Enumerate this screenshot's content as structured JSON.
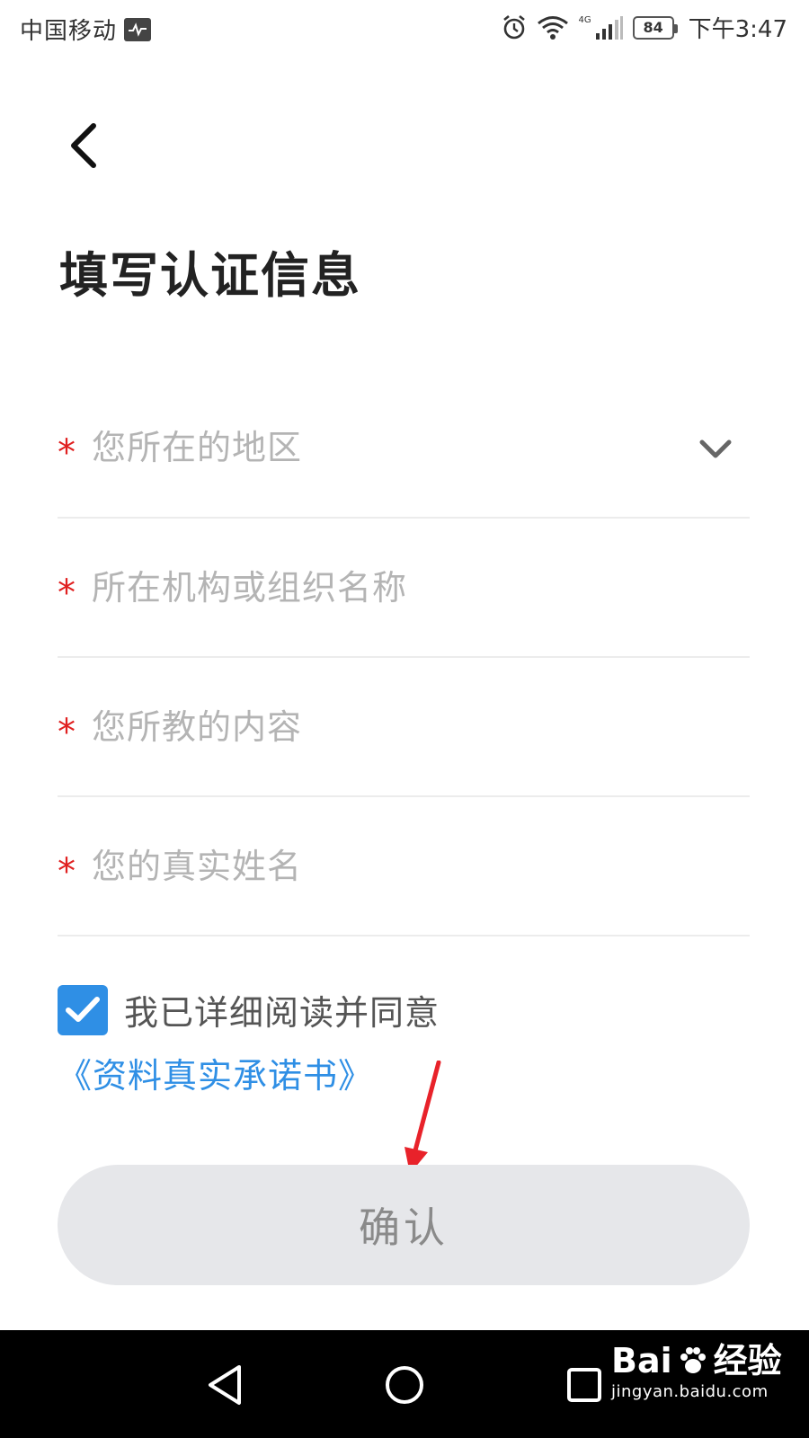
{
  "status_bar": {
    "carrier": "中国移动",
    "network": "4G",
    "battery": "84",
    "time": "下午3:47"
  },
  "page": {
    "title": "填写认证信息"
  },
  "form": {
    "fields": [
      {
        "placeholder": "您所在的地区",
        "required_mark": "*",
        "value": ""
      },
      {
        "placeholder": "所在机构或组织名称",
        "required_mark": "*",
        "value": ""
      },
      {
        "placeholder": "您所教的内容",
        "required_mark": "*",
        "value": ""
      },
      {
        "placeholder": "您的真实姓名",
        "required_mark": "*",
        "value": ""
      }
    ]
  },
  "agreement": {
    "text": "我已详细阅读并同意",
    "link": "《资料真实承诺书》",
    "checked": true
  },
  "confirm": {
    "label": "确认"
  },
  "watermark": {
    "brand": "Bai",
    "brand_suffix": "经验",
    "url": "jingyan.baidu.com"
  },
  "colors": {
    "accent": "#2f8fe5",
    "required": "#e02020",
    "button_bg": "#e6e7ea"
  }
}
